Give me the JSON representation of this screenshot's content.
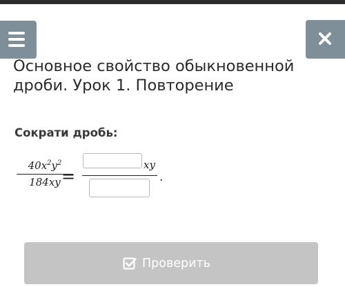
{
  "header": {
    "menu_icon": "hamburger-icon",
    "close_icon": "close-icon",
    "lesson_title": "Основное свойство обыкновенной дроби. Урок 1. Повторение"
  },
  "task": {
    "prompt": "Сократи дробь:",
    "given_fraction": {
      "numerator_coefficient": "40",
      "numerator_var1": "x",
      "numerator_exp1": "2",
      "numerator_var2": "y",
      "numerator_exp2": "2",
      "denominator": "184xy"
    },
    "equals_sign": "=",
    "answer_numerator_value": "",
    "answer_numerator_suffix": "xy",
    "answer_denominator_value": "",
    "trailing_period": "."
  },
  "actions": {
    "check_label": "Проверить",
    "check_icon": "checkbox-check-icon"
  },
  "colors": {
    "header_button_bg": "#7f8f9a",
    "check_button_bg": "#c4c4c4",
    "top_strip": "#2c2c2c"
  }
}
